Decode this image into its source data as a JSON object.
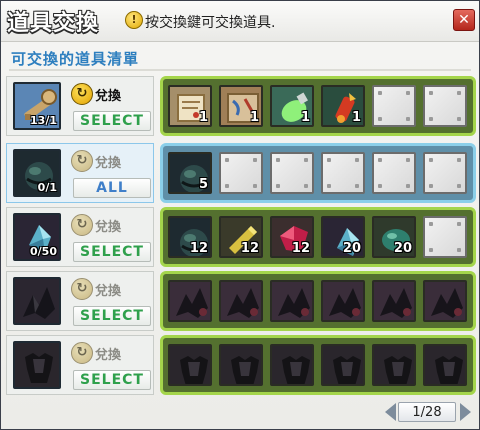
{
  "title": "道具交換",
  "hint": {
    "icon": "warning-icon",
    "text": "按交換鍵可交換道具."
  },
  "section_title": "可交換的道具清單",
  "exchange_label": "兌換",
  "rows": [
    {
      "thumb_icon": "key-icon",
      "count": "13/1",
      "exchange_enabled": true,
      "select_label": "SELECT",
      "slots": [
        {
          "icon": "scroll-icon",
          "count": "1"
        },
        {
          "icon": "map-icon",
          "count": "1"
        },
        {
          "icon": "green-potion-icon",
          "count": "1"
        },
        {
          "icon": "red-rocket-icon",
          "count": "1"
        },
        {
          "icon": "",
          "count": ""
        },
        {
          "icon": "",
          "count": ""
        }
      ]
    },
    {
      "thumb_icon": "dark-orb-icon",
      "count": "0/1",
      "exchange_enabled": false,
      "select_label": "ALL",
      "slots": [
        {
          "icon": "dark-orb-icon",
          "count": "5"
        },
        {
          "icon": "",
          "count": ""
        },
        {
          "icon": "",
          "count": ""
        },
        {
          "icon": "",
          "count": ""
        },
        {
          "icon": "",
          "count": ""
        },
        {
          "icon": "",
          "count": ""
        }
      ]
    },
    {
      "thumb_icon": "blue-crystal-icon",
      "count": "0/50",
      "exchange_enabled": false,
      "select_label": "SELECT",
      "slots": [
        {
          "icon": "dark-orb-icon",
          "count": "12"
        },
        {
          "icon": "gold-bar-icon",
          "count": "12"
        },
        {
          "icon": "red-gem-icon",
          "count": "12"
        },
        {
          "icon": "blue-crystal-icon",
          "count": "20"
        },
        {
          "icon": "teal-orb-icon",
          "count": "20"
        },
        {
          "icon": "",
          "count": ""
        }
      ]
    },
    {
      "thumb_icon": "black-mecha-icon",
      "count": "",
      "exchange_enabled": false,
      "select_label": "SELECT",
      "slots": [
        {
          "icon": "mecha-part-icon",
          "count": ""
        },
        {
          "icon": "mecha-part-icon",
          "count": ""
        },
        {
          "icon": "mecha-part-icon",
          "count": ""
        },
        {
          "icon": "mecha-part-icon",
          "count": ""
        },
        {
          "icon": "mecha-part-icon",
          "count": ""
        },
        {
          "icon": "mecha-part-icon",
          "count": ""
        }
      ]
    },
    {
      "thumb_icon": "black-armor-icon",
      "count": "",
      "exchange_enabled": false,
      "select_label": "SELECT",
      "slots": [
        {
          "icon": "black-armor-icon",
          "count": ""
        },
        {
          "icon": "black-armor-icon",
          "count": ""
        },
        {
          "icon": "black-armor-icon",
          "count": ""
        },
        {
          "icon": "black-armor-icon",
          "count": ""
        },
        {
          "icon": "black-armor-icon",
          "count": ""
        },
        {
          "icon": "black-armor-icon",
          "count": ""
        }
      ]
    }
  ],
  "pager": {
    "text": "1/28"
  }
}
